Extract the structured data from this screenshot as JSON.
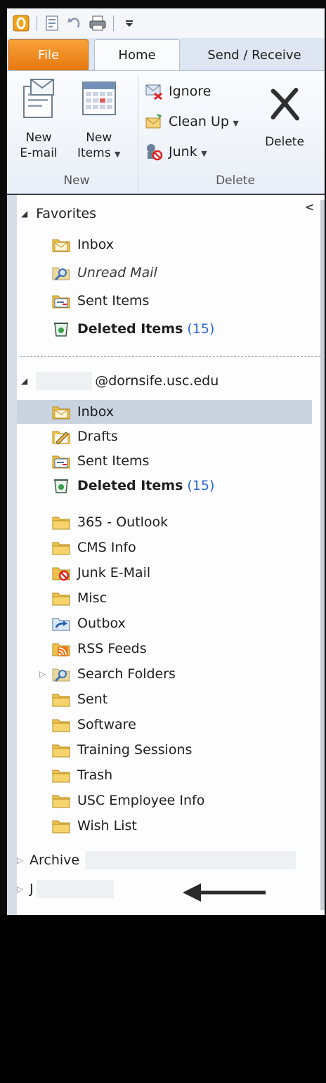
{
  "ribbon": {
    "tabs": {
      "file": "File",
      "home": "Home",
      "send_receive": "Send / Receive"
    },
    "new_group": {
      "label": "New",
      "new_email": {
        "line1": "New",
        "line2": "E-mail"
      },
      "new_items": {
        "line1": "New",
        "line2": "Items"
      }
    },
    "delete_group": {
      "label": "Delete",
      "ignore": "Ignore",
      "clean_up": "Clean Up",
      "junk": "Junk",
      "delete": "Delete"
    }
  },
  "nav": {
    "favorites": {
      "title": "Favorites",
      "items": [
        {
          "label": "Inbox",
          "icon": "inbox-folder-icon"
        },
        {
          "label": "Unread Mail",
          "icon": "search-folder-icon"
        },
        {
          "label": "Sent Items",
          "icon": "sent-folder-icon"
        },
        {
          "label": "Deleted Items",
          "count": "(15)",
          "icon": "deleted-folder-icon"
        }
      ]
    },
    "account": {
      "email": "@dornsife.usc.edu",
      "items": [
        {
          "label": "Inbox",
          "icon": "inbox-folder-icon"
        },
        {
          "label": "Drafts",
          "icon": "drafts-folder-icon"
        },
        {
          "label": "Sent Items",
          "icon": "sent-folder-icon"
        },
        {
          "label": "Deleted Items",
          "count": "(15)",
          "icon": "deleted-folder-icon"
        },
        {
          "label": "365 - Outlook",
          "icon": "folder-icon"
        },
        {
          "label": "CMS Info",
          "icon": "folder-icon"
        },
        {
          "label": "Junk E-Mail",
          "icon": "junk-folder-icon"
        },
        {
          "label": "Misc",
          "icon": "folder-icon"
        },
        {
          "label": "Outbox",
          "icon": "outbox-folder-icon"
        },
        {
          "label": "RSS Feeds",
          "icon": "rss-folder-icon"
        },
        {
          "label": "Search Folders",
          "icon": "search-folder-icon"
        },
        {
          "label": "Sent",
          "icon": "folder-icon"
        },
        {
          "label": "Software",
          "icon": "folder-icon"
        },
        {
          "label": "Training Sessions",
          "icon": "folder-icon"
        },
        {
          "label": "Trash",
          "icon": "folder-icon"
        },
        {
          "label": "USC Employee Info",
          "icon": "folder-icon"
        },
        {
          "label": "Wish List",
          "icon": "folder-icon"
        }
      ]
    },
    "archive": "Archive",
    "other_account": "J"
  },
  "colors": {
    "accent": "#e8770f",
    "selection": "#c9d3df",
    "count": "#2a6ad8"
  }
}
